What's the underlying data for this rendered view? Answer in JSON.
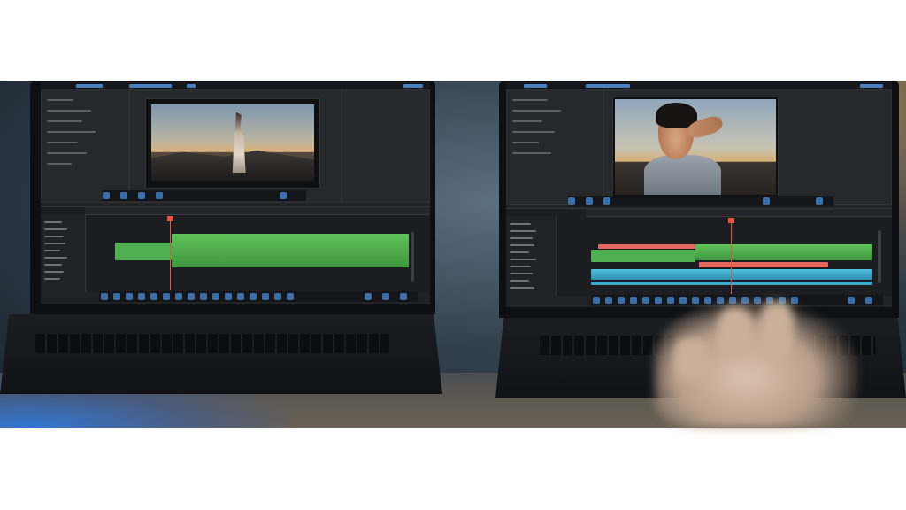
{
  "scene": {
    "description_colors": {
      "background": "#ffffff",
      "ui_panel": "#26282c",
      "ui_accent_blue": "#3b6ea8",
      "video_track_green": "#4fb04f",
      "audio_track_blue": "#3aa8c9",
      "clip_red": "#e2685e",
      "playhead": "#e8533b"
    },
    "laptops": [
      {
        "side": "left",
        "video_subject": "woman-on-rocks-at-sunset"
      },
      {
        "side": "right",
        "video_subject": "man-close-up-outdoors"
      }
    ]
  }
}
